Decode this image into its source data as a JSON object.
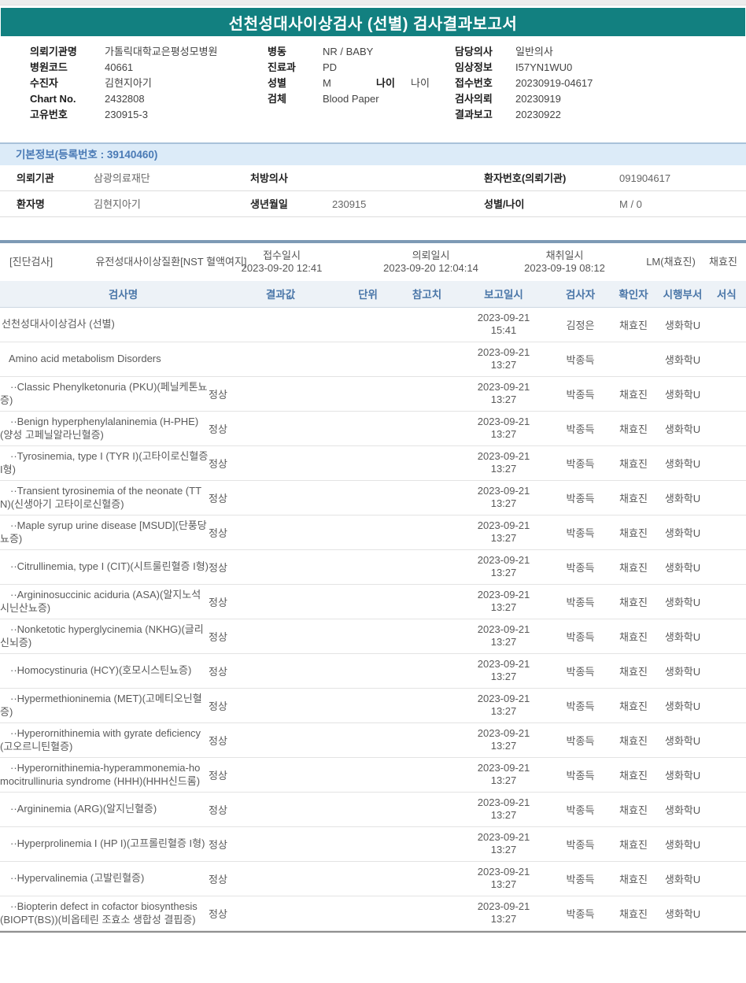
{
  "report": {
    "title": "선천성대사이상검사 (선별) 검사결과보고서"
  },
  "patient_info": {
    "org_label": "의뢰기관명",
    "org_value": "가톨릭대학교은평성모병원",
    "hospital_code_label": "병원코드",
    "hospital_code_value": "40661",
    "examinee_label": "수진자",
    "examinee_value": "김현지아기",
    "chart_no_label": "Chart No.",
    "chart_no_value": "2432808",
    "unique_no_label": "고유번호",
    "unique_no_value": "230915-3",
    "ward_label": "병동",
    "ward_value": "NR / BABY",
    "dept_label": "진료과",
    "dept_value": "PD",
    "sex_label": "성별",
    "sex_value": "M",
    "age_label": "나이",
    "age_value": "나이",
    "specimen_label": "검체",
    "specimen_value": "Blood Paper",
    "doctor_label": "담당의사",
    "doctor_value": "일반의사",
    "clinical_label": "임상정보",
    "clinical_value": "I57YN1WU0",
    "receipt_no_label": "접수번호",
    "receipt_no_value": "20230919-04617",
    "request_label": "검사의뢰",
    "request_value": "20230919",
    "report_label": "결과보고",
    "report_value": "20230922"
  },
  "basic_info": {
    "header": "기본정보(등록번호 : 39140460)",
    "row1": {
      "org_label": "의뢰기관",
      "org_value": "삼광의료재단",
      "doctor_label": "처방의사",
      "doctor_value": "",
      "patient_no_label": "환자번호(의뢰기관)",
      "patient_no_value": "091904617"
    },
    "row2": {
      "name_label": "환자명",
      "name_value": "김현지아기",
      "birth_label": "생년월일",
      "birth_value": "230915",
      "sex_age_label": "성별/나이",
      "sex_age_value": "M / 0"
    }
  },
  "diagnosis": {
    "tag": "[진단검사]",
    "test_name": "유전성대사이상질환[NST 혈액여지]",
    "receipt_label": "접수일시",
    "receipt_value": "2023-09-20 12:41",
    "request_label": "의뢰일시",
    "request_value": "2023-09-20 12:04:14",
    "collect_label": "채취일시",
    "collect_value": "2023-09-19 08:12",
    "collector": "LM(채효진)",
    "collector2": "채효진"
  },
  "results": {
    "headers": {
      "name": "검사명",
      "result": "결과값",
      "unit": "단위",
      "ref": "참고치",
      "report_at": "보고일시",
      "tester": "검사자",
      "confirmer": "확인자",
      "dept": "시행부서",
      "form": "서식"
    },
    "rows": [
      {
        "level": 0,
        "name": "선천성대사이상검사 (선별)",
        "result": "",
        "unit": "",
        "ref": "",
        "date": "2023-09-21",
        "time": "15:41",
        "tester": "김정은",
        "confirmer": "채효진",
        "dept": "생화학U",
        "form": ""
      },
      {
        "level": 1,
        "name": "Amino acid metabolism Disorders",
        "result": "",
        "unit": "",
        "ref": "",
        "date": "2023-09-21",
        "time": "13:27",
        "tester": "박종득",
        "confirmer": "",
        "dept": "생화학U",
        "form": ""
      },
      {
        "level": 2,
        "name": "··Classic Phenylketonuria (PKU)(페닐케톤뇨증)",
        "result": "정상",
        "unit": "",
        "ref": "",
        "date": "2023-09-21",
        "time": "13:27",
        "tester": "박종득",
        "confirmer": "채효진",
        "dept": "생화학U",
        "form": ""
      },
      {
        "level": 2,
        "name": "··Benign hyperphenylalaninemia (H-PHE)(양성 고페닐알라닌혈증)",
        "result": "정상",
        "unit": "",
        "ref": "",
        "date": "2023-09-21",
        "time": "13:27",
        "tester": "박종득",
        "confirmer": "채효진",
        "dept": "생화학U",
        "form": ""
      },
      {
        "level": 2,
        "name": "··Tyrosinemia, type I (TYR I)(고타이로신혈증 I형)",
        "result": "정상",
        "unit": "",
        "ref": "",
        "date": "2023-09-21",
        "time": "13:27",
        "tester": "박종득",
        "confirmer": "채효진",
        "dept": "생화학U",
        "form": ""
      },
      {
        "level": 2,
        "name": "··Transient tyrosinemia of the neonate (TTN)(신생아기 고타이로신혈증)",
        "result": "정상",
        "unit": "",
        "ref": "",
        "date": "2023-09-21",
        "time": "13:27",
        "tester": "박종득",
        "confirmer": "채효진",
        "dept": "생화학U",
        "form": ""
      },
      {
        "level": 2,
        "name": "··Maple syrup urine disease [MSUD](단풍당뇨증)",
        "result": "정상",
        "unit": "",
        "ref": "",
        "date": "2023-09-21",
        "time": "13:27",
        "tester": "박종득",
        "confirmer": "채효진",
        "dept": "생화학U",
        "form": ""
      },
      {
        "level": 2,
        "name": "··Citrullinemia, type I (CIT)(시트룰린혈증 I형)",
        "result": "정상",
        "unit": "",
        "ref": "",
        "date": "2023-09-21",
        "time": "13:27",
        "tester": "박종득",
        "confirmer": "채효진",
        "dept": "생화학U",
        "form": ""
      },
      {
        "level": 2,
        "name": "··Argininosuccinic aciduria (ASA)(알지노석시닌산뇨증)",
        "result": "정상",
        "unit": "",
        "ref": "",
        "date": "2023-09-21",
        "time": "13:27",
        "tester": "박종득",
        "confirmer": "채효진",
        "dept": "생화학U",
        "form": ""
      },
      {
        "level": 2,
        "name": "··Nonketotic hyperglycinemia (NKHG)(글리신뇌증)",
        "result": "정상",
        "unit": "",
        "ref": "",
        "date": "2023-09-21",
        "time": "13:27",
        "tester": "박종득",
        "confirmer": "채효진",
        "dept": "생화학U",
        "form": ""
      },
      {
        "level": 2,
        "name": "··Homocystinuria (HCY)(호모시스틴뇨증)",
        "result": "정상",
        "unit": "",
        "ref": "",
        "date": "2023-09-21",
        "time": "13:27",
        "tester": "박종득",
        "confirmer": "채효진",
        "dept": "생화학U",
        "form": ""
      },
      {
        "level": 2,
        "name": "··Hypermethioninemia (MET)(고메티오닌혈증)",
        "result": "정상",
        "unit": "",
        "ref": "",
        "date": "2023-09-21",
        "time": "13:27",
        "tester": "박종득",
        "confirmer": "채효진",
        "dept": "생화학U",
        "form": ""
      },
      {
        "level": 2,
        "name": "··Hyperornithinemia with gyrate deficiency(고오르니틴혈증)",
        "result": "정상",
        "unit": "",
        "ref": "",
        "date": "2023-09-21",
        "time": "13:27",
        "tester": "박종득",
        "confirmer": "채효진",
        "dept": "생화학U",
        "form": ""
      },
      {
        "level": 2,
        "name": "··Hyperornithinemia-hyperammonemia-homocitrullinuria syndrome (HHH)(HHH신드롬)",
        "result": "정상",
        "unit": "",
        "ref": "",
        "date": "2023-09-21",
        "time": "13:27",
        "tester": "박종득",
        "confirmer": "채효진",
        "dept": "생화학U",
        "form": ""
      },
      {
        "level": 2,
        "name": "··Argininemia (ARG)(알지닌혈증)",
        "result": "정상",
        "unit": "",
        "ref": "",
        "date": "2023-09-21",
        "time": "13:27",
        "tester": "박종득",
        "confirmer": "채효진",
        "dept": "생화학U",
        "form": ""
      },
      {
        "level": 2,
        "name": "··Hyperprolinemia I (HP I)(고프롤린혈증 I형)",
        "result": "정상",
        "unit": "",
        "ref": "",
        "date": "2023-09-21",
        "time": "13:27",
        "tester": "박종득",
        "confirmer": "채효진",
        "dept": "생화학U",
        "form": ""
      },
      {
        "level": 2,
        "name": "··Hypervalinemia (고발린혈증)",
        "result": "정상",
        "unit": "",
        "ref": "",
        "date": "2023-09-21",
        "time": "13:27",
        "tester": "박종득",
        "confirmer": "채효진",
        "dept": "생화학U",
        "form": ""
      },
      {
        "level": 2,
        "name": "··Biopterin defect in cofactor biosynthesis (BIOPT(BS))(비옵테린 조효소 생합성 결핍증)",
        "result": "정상",
        "unit": "",
        "ref": "",
        "date": "2023-09-21",
        "time": "13:27",
        "tester": "박종득",
        "confirmer": "채효진",
        "dept": "생화학U",
        "form": ""
      }
    ]
  },
  "colors": {
    "header_teal": "#128080",
    "section_blue_text": "#4a7ab5",
    "section_blue_bg": "#dcebf8",
    "divider_slate": "#7d9ab5",
    "table_header_text": "#4a76a8",
    "table_header_bg": "#edf2f7"
  }
}
